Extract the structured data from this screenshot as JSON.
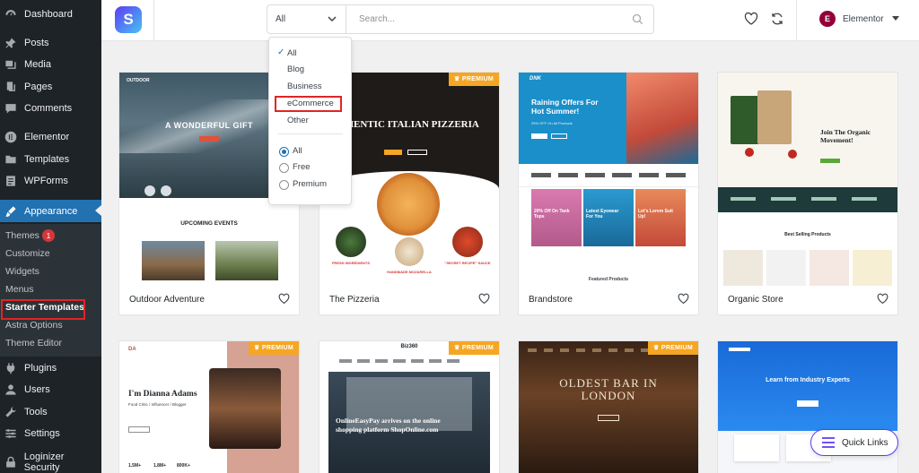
{
  "sidebar": {
    "items": [
      {
        "label": "Dashboard",
        "icon": "dashboard-icon"
      },
      {
        "label": "Posts",
        "icon": "pin-icon"
      },
      {
        "label": "Media",
        "icon": "media-icon"
      },
      {
        "label": "Pages",
        "icon": "pages-icon"
      },
      {
        "label": "Comments",
        "icon": "comment-icon"
      },
      {
        "label": "Elementor",
        "icon": "elementor-icon"
      },
      {
        "label": "Templates",
        "icon": "folder-icon"
      },
      {
        "label": "WPForms",
        "icon": "form-icon"
      },
      {
        "label": "Appearance",
        "icon": "brush-icon"
      },
      {
        "label": "Plugins",
        "icon": "plug-icon"
      },
      {
        "label": "Users",
        "icon": "user-icon"
      },
      {
        "label": "Tools",
        "icon": "wrench-icon"
      },
      {
        "label": "Settings",
        "icon": "settings-icon"
      },
      {
        "label": "Loginizer Security",
        "icon": "lock-icon"
      }
    ],
    "appearance_submenu": [
      {
        "label": "Themes",
        "badge": "1"
      },
      {
        "label": "Customize"
      },
      {
        "label": "Widgets"
      },
      {
        "label": "Menus"
      },
      {
        "label": "Starter Templates"
      },
      {
        "label": "Astra Options"
      },
      {
        "label": "Theme Editor"
      }
    ]
  },
  "header": {
    "filter_selected": "All",
    "search_placeholder": "Search...",
    "builder_label": "Elementor",
    "builder_logo": "E"
  },
  "dropdown": {
    "categories": [
      "All",
      "Blog",
      "Business",
      "eCommerce",
      "Other"
    ],
    "selected_category": "All",
    "types": [
      "All",
      "Free",
      "Premium"
    ],
    "selected_type": "All"
  },
  "cards": [
    {
      "title": "Outdoor Adventure",
      "premium": false
    },
    {
      "title": "The Pizzeria",
      "premium": true
    },
    {
      "title": "Brandstore",
      "premium": false
    },
    {
      "title": "Organic Store",
      "premium": false
    },
    {
      "title": "",
      "premium": true
    },
    {
      "title": "",
      "premium": true
    },
    {
      "title": "",
      "premium": true
    },
    {
      "title": "",
      "premium": false
    }
  ],
  "premium_label": "PREMIUM",
  "thumbs": {
    "outdoor": {
      "brand": "OUTDOOR",
      "headline": "A WONDERFUL GIFT",
      "section": "UPCOMING EVENTS"
    },
    "pizzeria": {
      "headline": "THENTIC ITALIAN PIZZERIA",
      "f1": "FRESH INGREDIENTS",
      "f2": "HANDMADE MOZARELLA",
      "f3": "\"SECRET RECIPE\" SAUCE"
    },
    "brandstore": {
      "brand": "DNK",
      "headline": "Raining Offers For Hot Summer!",
      "sub": "25% OFF On All Products",
      "p1": "20% Off On Tank Tops",
      "p2": "Latest Eyewear For You",
      "p3": "Let's Lorem Suit Up!",
      "footer": "Featured Products"
    },
    "organic": {
      "headline": "Join The Organic Movement!",
      "section": "Best Selling Products"
    },
    "dianna": {
      "headline": "I'm Dianna Adams",
      "sub": "Food Critic / Influencer / Blogger",
      "s1": "1.5M+",
      "s2": "1.8M+",
      "s3": "800K+"
    },
    "biz": {
      "brand": "Biz360",
      "headline": "OnlineEasyPay arrives on the online shopping platform ShopOnline.com"
    },
    "bar": {
      "headline": "OLDEST BAR IN LONDON"
    },
    "learn": {
      "headline": "Learn from Industry Experts"
    }
  },
  "quick_links_label": "Quick Links",
  "colors": {
    "wp_sidebar": "#1d2327",
    "wp_active": "#2271b1",
    "premium": "#f5a623",
    "highlight": "#e02424",
    "brand_purple": "#5d3bf2"
  }
}
